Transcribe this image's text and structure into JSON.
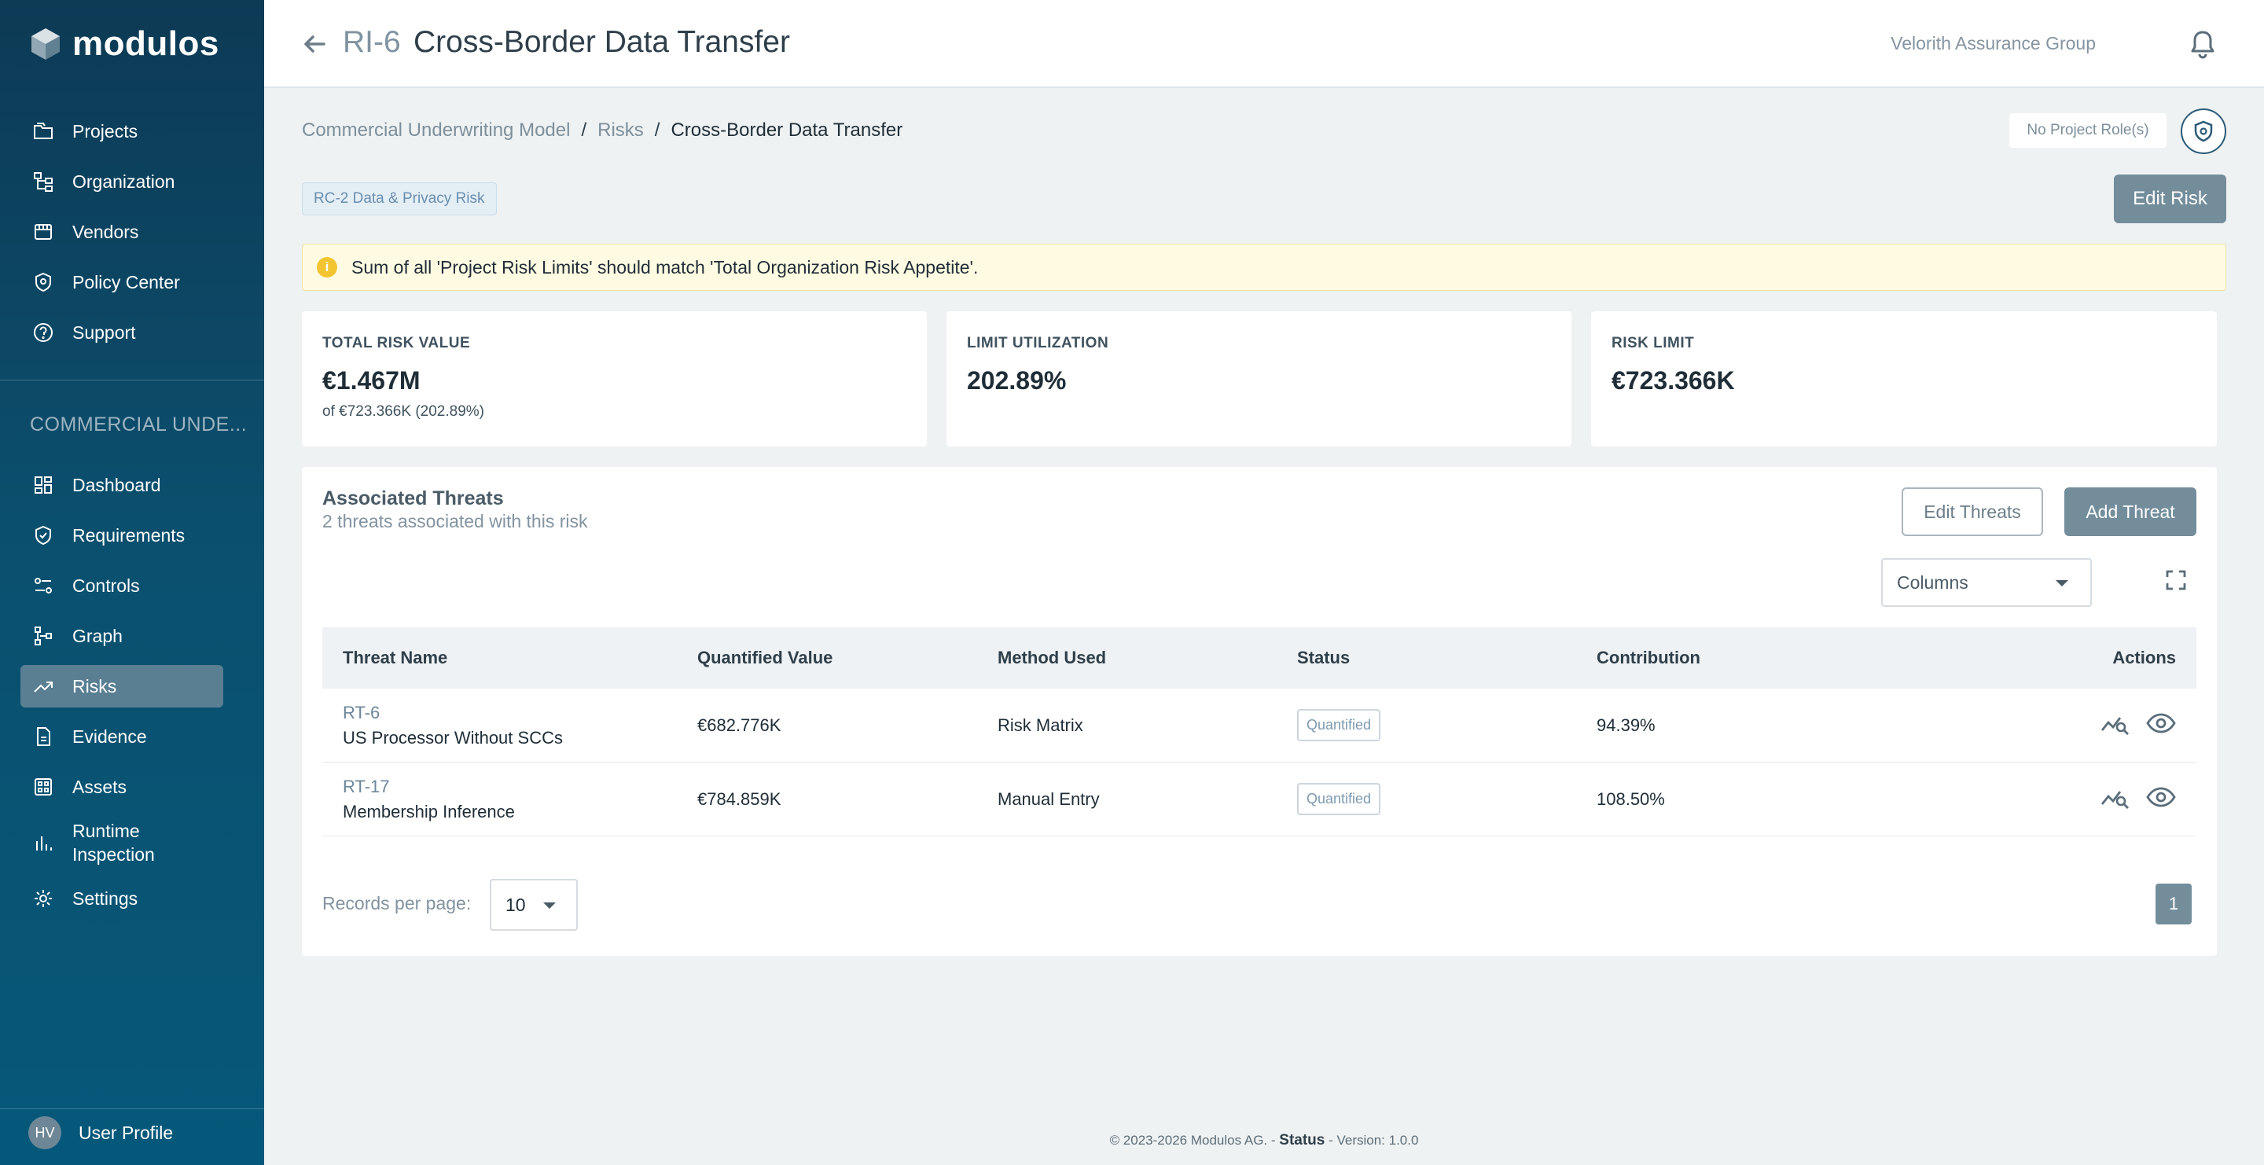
{
  "sidebar": {
    "brand": "modulos",
    "top_items": [
      {
        "label": "Projects",
        "icon": "folder-icon"
      },
      {
        "label": "Organization",
        "icon": "org-chart-icon"
      },
      {
        "label": "Vendors",
        "icon": "store-icon"
      },
      {
        "label": "Policy Center",
        "icon": "shield-icon"
      },
      {
        "label": "Support",
        "icon": "help-icon"
      }
    ],
    "section_title": "COMMERCIAL UNDE...",
    "project_items": [
      {
        "label": "Dashboard",
        "icon": "dashboard-icon"
      },
      {
        "label": "Requirements",
        "icon": "shield-check-icon"
      },
      {
        "label": "Controls",
        "icon": "toggles-icon"
      },
      {
        "label": "Graph",
        "icon": "graph-icon"
      },
      {
        "label": "Risks",
        "icon": "trending-icon",
        "active": true
      },
      {
        "label": "Evidence",
        "icon": "document-icon"
      },
      {
        "label": "Assets",
        "icon": "grid-icon"
      },
      {
        "label": "Runtime Inspection",
        "icon": "bar-chart-icon"
      },
      {
        "label": "Settings",
        "icon": "gear-icon"
      }
    ],
    "user": {
      "initials": "HV",
      "label": "User Profile"
    }
  },
  "header": {
    "risk_id": "RI-6",
    "title": "Cross-Border Data Transfer",
    "organization": "Velorith Assurance Group"
  },
  "breadcrumb": {
    "items": [
      "Commercial Underwriting Model",
      "Risks"
    ],
    "current": "Cross-Border Data Transfer",
    "separator": "/"
  },
  "project_role": "No Project Role(s)",
  "risk_category_tag": "RC-2 Data & Privacy Risk",
  "edit_risk_label": "Edit Risk",
  "alert": {
    "icon": "i",
    "text": "Sum of all 'Project Risk Limits' should match 'Total Organization Risk Appetite'."
  },
  "kpis": [
    {
      "heading": "TOTAL RISK VALUE",
      "value": "€1.467M",
      "sub": "of €723.366K (202.89%)"
    },
    {
      "heading": "LIMIT UTILIZATION",
      "value": "202.89%",
      "sub": ""
    },
    {
      "heading": "RISK LIMIT",
      "value": "€723.366K",
      "sub": ""
    }
  ],
  "threats": {
    "title": "Associated Threats",
    "subtitle": "2 threats associated with this risk",
    "edit_label": "Edit Threats",
    "add_label": "Add Threat",
    "columns_label": "Columns",
    "headers": [
      "Threat Name",
      "Quantified Value",
      "Method Used",
      "Status",
      "Contribution",
      "Actions"
    ],
    "rows": [
      {
        "id": "RT-6",
        "name": "US Processor Without SCCs",
        "value": "€682.776K",
        "method": "Risk Matrix",
        "status": "Quantified",
        "contribution": "94.39%"
      },
      {
        "id": "RT-17",
        "name": "Membership Inference",
        "value": "€784.859K",
        "method": "Manual Entry",
        "status": "Quantified",
        "contribution": "108.50%"
      }
    ],
    "records_label": "Records per page:",
    "records_value": "10",
    "page": "1"
  },
  "footer": {
    "copyright": "© 2023-2026 Modulos AG. -",
    "status": "Status",
    "version": "- Version: 1.0.0"
  }
}
